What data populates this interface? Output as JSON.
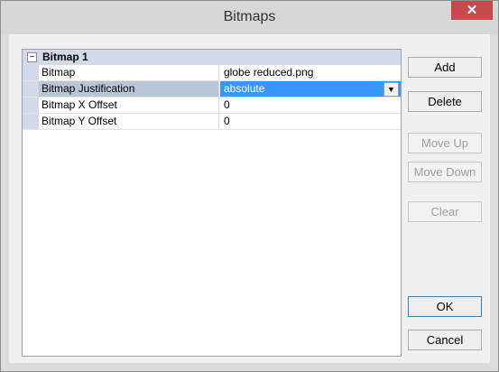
{
  "window": {
    "title": "Bitmaps",
    "close_label": "✕"
  },
  "property_grid": {
    "category": {
      "toggle": "−",
      "label": "Bitmap 1"
    },
    "rows": [
      {
        "name": "Bitmap",
        "value": "globe reduced.png"
      },
      {
        "name": "Bitmap Justification",
        "value": "absolute"
      },
      {
        "name": "Bitmap X Offset",
        "value": "0"
      },
      {
        "name": "Bitmap Y Offset",
        "value": "0"
      }
    ],
    "dropdown_icon": "dropdown-arrow-icon",
    "dropdown_glyph": "▼"
  },
  "buttons": {
    "add": "Add",
    "delete": "Delete",
    "move_up": "Move Up",
    "move_down": "Move Down",
    "clear": "Clear",
    "ok": "OK",
    "cancel": "Cancel"
  },
  "colors": {
    "accent_selection": "#3399ff",
    "category_bg": "#d4d8e8",
    "close_button": "#c74a4a"
  }
}
